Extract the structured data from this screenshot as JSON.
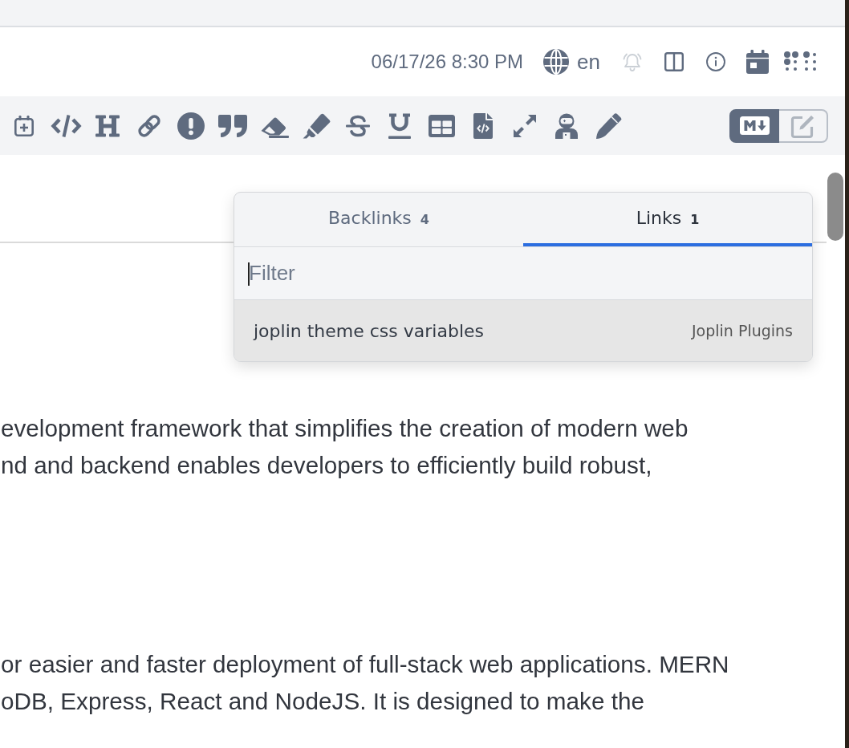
{
  "header": {
    "datetime": "06/17/26 8:30 PM",
    "language": "en",
    "notification_bell": {
      "disabled": true
    }
  },
  "editor_toggle": [
    {
      "selected": true
    },
    {
      "selected": false
    }
  ],
  "note": {
    "paragraphs": [
      {
        "lines": [
          "evelopment framework that simplifies the creation of modern web",
          "nd and backend enables developers to efficiently build robust,"
        ]
      },
      {
        "lines": [
          "or easier and faster deployment of full-stack web applications. MERN",
          "oDB, Express, React and NodeJS. It is designed to make the"
        ]
      }
    ]
  },
  "links_panel": {
    "tabs": [
      {
        "label": "Backlinks",
        "count": "4",
        "selected": false
      },
      {
        "label": "Links",
        "count": "1",
        "selected": true
      }
    ],
    "filter": {
      "placeholder": "Filter",
      "focused": true
    },
    "results": [
      {
        "title": "joplin theme css variables",
        "notebook": "Joplin Plugins",
        "selected": true
      }
    ]
  }
}
